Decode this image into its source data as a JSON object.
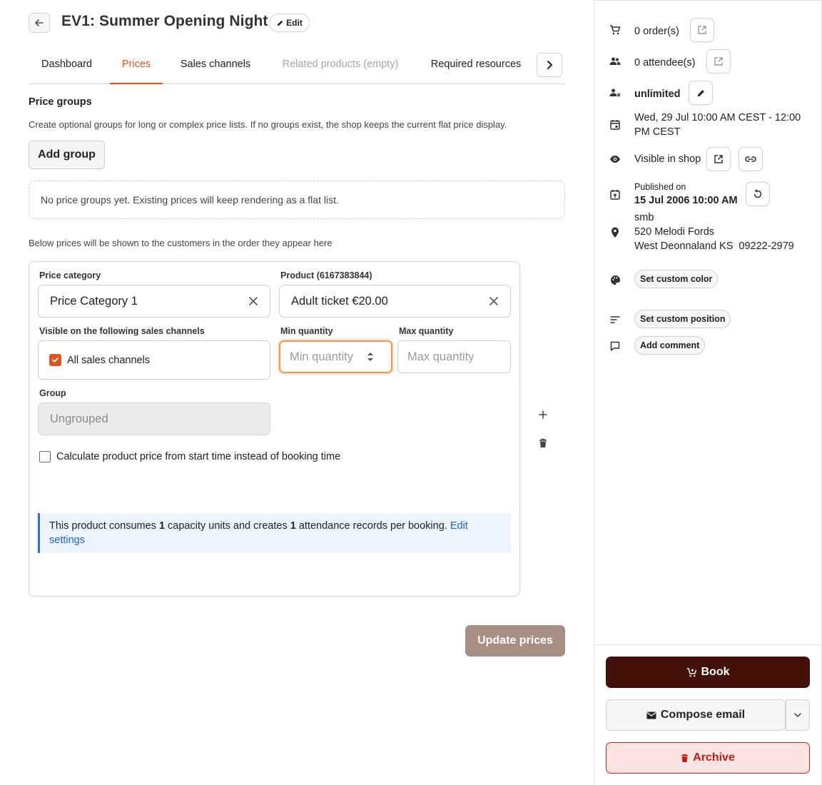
{
  "header": {
    "title": "EV1: Summer Opening Night",
    "edit_label": "Edit"
  },
  "tabs": [
    {
      "label": "Dashboard",
      "state": "normal"
    },
    {
      "label": "Prices",
      "state": "active"
    },
    {
      "label": "Sales channels",
      "state": "normal"
    },
    {
      "label": "Related products (empty)",
      "state": "disabled"
    },
    {
      "label": "Required resources",
      "state": "normal"
    }
  ],
  "price_groups": {
    "title": "Price groups",
    "description": "Create optional groups for long or complex price lists. If no groups exist, the shop keeps the current flat price display.",
    "add_button": "Add group",
    "empty_message": "No price groups yet. Existing prices will keep rendering as a flat list."
  },
  "order_note": "Below prices will be shown to the customers in the order they appear here",
  "price_row": {
    "category_label": "Price category",
    "category_value": "Price Category 1",
    "product_label": "Product (6167383844)",
    "product_value": "Adult ticket €20.00",
    "channels_label": "Visible on the following sales channels",
    "channels_value": "All sales channels",
    "channels_checked": true,
    "min_label": "Min quantity",
    "min_placeholder": "Min quantity",
    "max_label": "Max quantity",
    "max_placeholder": "Max quantity",
    "group_label": "Group",
    "group_value": "Ungrouped",
    "start_time_label": "Calculate product price from start time instead of booking time",
    "start_time_checked": false,
    "info": {
      "prefix": "This product consumes ",
      "capacity_units": "1",
      "middle": " capacity units and creates ",
      "attendance_records": "1",
      "suffix": " attendance records per booking. ",
      "link": "Edit settings"
    }
  },
  "update_button": "Update prices",
  "sidebar": {
    "orders": "0 order(s)",
    "attendees": "0 attendee(s)",
    "capacity": "unlimited",
    "date_range": "Wed, 29 Jul 10:00 AM CEST - 12:00 PM CEST",
    "visibility": "Visible in shop",
    "published_label": "Published on",
    "published_value": "15 Jul 2006 10:00 AM",
    "location_name": "smb",
    "location_street": "520 Melodi Fords",
    "location_city": "West Deonnaland KS  09222-2979",
    "custom_color": "Set custom color",
    "custom_position": "Set custom position",
    "add_comment": "Add comment",
    "book": "Book",
    "compose_email": "Compose email",
    "archive": "Archive"
  },
  "colors": {
    "accent": "#e0531d",
    "book_bg": "#431108",
    "update_bg": "#a88f86",
    "archive_fg": "#c01b12",
    "info_border": "#2d6fd6"
  }
}
